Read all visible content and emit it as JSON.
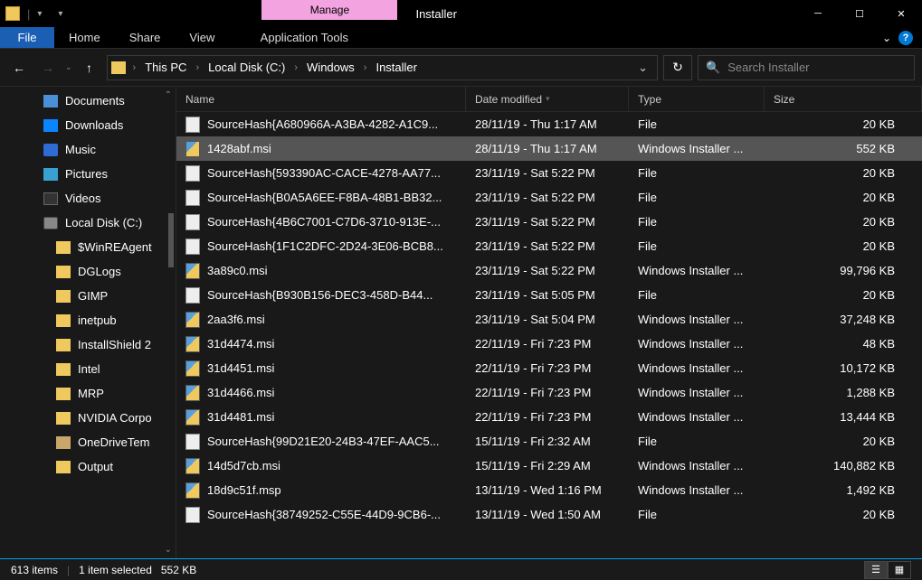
{
  "window": {
    "title": "Installer",
    "ribbon_context_label": "Manage",
    "tabs": {
      "file": "File",
      "home": "Home",
      "share": "Share",
      "view": "View",
      "app_tools": "Application Tools"
    }
  },
  "breadcrumb": [
    "This PC",
    "Local Disk (C:)",
    "Windows",
    "Installer"
  ],
  "search": {
    "placeholder": "Search Installer"
  },
  "columns": {
    "name": "Name",
    "date": "Date modified",
    "type": "Type",
    "size": "Size"
  },
  "sidebar": [
    {
      "label": "Documents",
      "icon": "doc",
      "depth": 0
    },
    {
      "label": "Downloads",
      "icon": "dl",
      "depth": 0
    },
    {
      "label": "Music",
      "icon": "music",
      "depth": 0
    },
    {
      "label": "Pictures",
      "icon": "pic",
      "depth": 0
    },
    {
      "label": "Videos",
      "icon": "vid",
      "depth": 0
    },
    {
      "label": "Local Disk (C:)",
      "icon": "disk",
      "depth": 0
    },
    {
      "label": "$WinREAgent",
      "icon": "folder",
      "depth": 1
    },
    {
      "label": "DGLogs",
      "icon": "folder",
      "depth": 1
    },
    {
      "label": "GIMP",
      "icon": "folder",
      "depth": 1
    },
    {
      "label": "inetpub",
      "icon": "folder",
      "depth": 1
    },
    {
      "label": "InstallShield 2",
      "icon": "folder",
      "depth": 1
    },
    {
      "label": "Intel",
      "icon": "folder",
      "depth": 1
    },
    {
      "label": "MRP",
      "icon": "folder",
      "depth": 1
    },
    {
      "label": "NVIDIA Corpo",
      "icon": "folder",
      "depth": 1
    },
    {
      "label": "OneDriveTem",
      "icon": "folder-lt",
      "depth": 1
    },
    {
      "label": "Output",
      "icon": "folder",
      "depth": 1
    }
  ],
  "files": [
    {
      "name": "SourceHash{A680966A-A3BA-4282-A1C9...",
      "date": "28/11/19 - Thu 1:17 AM",
      "type": "File",
      "size": "20 KB",
      "icon": "file",
      "selected": false
    },
    {
      "name": "1428abf.msi",
      "date": "28/11/19 - Thu 1:17 AM",
      "type": "Windows Installer ...",
      "size": "552 KB",
      "icon": "msi",
      "selected": true
    },
    {
      "name": "SourceHash{593390AC-CACE-4278-AA77...",
      "date": "23/11/19 - Sat 5:22 PM",
      "type": "File",
      "size": "20 KB",
      "icon": "file",
      "selected": false
    },
    {
      "name": "SourceHash{B0A5A6EE-F8BA-48B1-BB32...",
      "date": "23/11/19 - Sat 5:22 PM",
      "type": "File",
      "size": "20 KB",
      "icon": "file",
      "selected": false
    },
    {
      "name": "SourceHash{4B6C7001-C7D6-3710-913E-...",
      "date": "23/11/19 - Sat 5:22 PM",
      "type": "File",
      "size": "20 KB",
      "icon": "file",
      "selected": false
    },
    {
      "name": "SourceHash{1F1C2DFC-2D24-3E06-BCB8...",
      "date": "23/11/19 - Sat 5:22 PM",
      "type": "File",
      "size": "20 KB",
      "icon": "file",
      "selected": false
    },
    {
      "name": "3a89c0.msi",
      "date": "23/11/19 - Sat 5:22 PM",
      "type": "Windows Installer ...",
      "size": "99,796 KB",
      "icon": "msi",
      "selected": false
    },
    {
      "name": "SourceHash{B930B156-DEC3-458D-B44...",
      "date": "23/11/19 - Sat 5:05 PM",
      "type": "File",
      "size": "20 KB",
      "icon": "file",
      "selected": false
    },
    {
      "name": "2aa3f6.msi",
      "date": "23/11/19 - Sat 5:04 PM",
      "type": "Windows Installer ...",
      "size": "37,248 KB",
      "icon": "msi",
      "selected": false
    },
    {
      "name": "31d4474.msi",
      "date": "22/11/19 - Fri 7:23 PM",
      "type": "Windows Installer ...",
      "size": "48 KB",
      "icon": "msi",
      "selected": false
    },
    {
      "name": "31d4451.msi",
      "date": "22/11/19 - Fri 7:23 PM",
      "type": "Windows Installer ...",
      "size": "10,172 KB",
      "icon": "msi",
      "selected": false
    },
    {
      "name": "31d4466.msi",
      "date": "22/11/19 - Fri 7:23 PM",
      "type": "Windows Installer ...",
      "size": "1,288 KB",
      "icon": "msi",
      "selected": false
    },
    {
      "name": "31d4481.msi",
      "date": "22/11/19 - Fri 7:23 PM",
      "type": "Windows Installer ...",
      "size": "13,444 KB",
      "icon": "msi",
      "selected": false
    },
    {
      "name": "SourceHash{99D21E20-24B3-47EF-AAC5...",
      "date": "15/11/19 - Fri 2:32 AM",
      "type": "File",
      "size": "20 KB",
      "icon": "file",
      "selected": false
    },
    {
      "name": "14d5d7cb.msi",
      "date": "15/11/19 - Fri 2:29 AM",
      "type": "Windows Installer ...",
      "size": "140,882 KB",
      "icon": "msi",
      "selected": false
    },
    {
      "name": "18d9c51f.msp",
      "date": "13/11/19 - Wed 1:16 PM",
      "type": "Windows Installer ...",
      "size": "1,492 KB",
      "icon": "msi",
      "selected": false
    },
    {
      "name": "SourceHash{38749252-C55E-44D9-9CB6-...",
      "date": "13/11/19 - Wed 1:50 AM",
      "type": "File",
      "size": "20 KB",
      "icon": "file",
      "selected": false
    }
  ],
  "status": {
    "items": "613 items",
    "selection": "1 item selected",
    "sel_size": "552 KB"
  }
}
